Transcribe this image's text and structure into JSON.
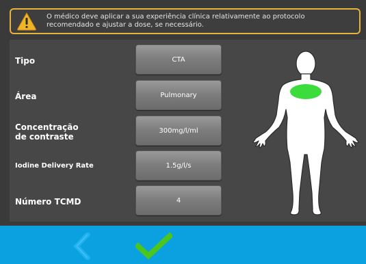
{
  "warning": {
    "icon": "warning-triangle-icon",
    "line1": "O médico deve aplicar a sua experiência clínica relativamente ao protocolo",
    "line2": "recomendado e ajustar a dose, se necessário."
  },
  "fields": [
    {
      "label": "Tipo",
      "value": "CTA"
    },
    {
      "label": "Área",
      "value": "Pulmonary"
    },
    {
      "label_line1": "Concentração",
      "label_line2": "de contraste",
      "value": "300mg/l/ml"
    },
    {
      "label": "Iodine Delivery Rate",
      "value": "1.5g/l/s"
    },
    {
      "label": "Número TCMD",
      "value": "4"
    }
  ],
  "body_diagram": {
    "highlight_region": "chest",
    "highlight_color": "#3ddc3d",
    "icon": "human-body-icon"
  },
  "footer": {
    "back_icon": "chevron-left-icon",
    "confirm_icon": "checkmark-icon",
    "back_color": "#1fb2f2",
    "confirm_color": "#4cc51d"
  }
}
